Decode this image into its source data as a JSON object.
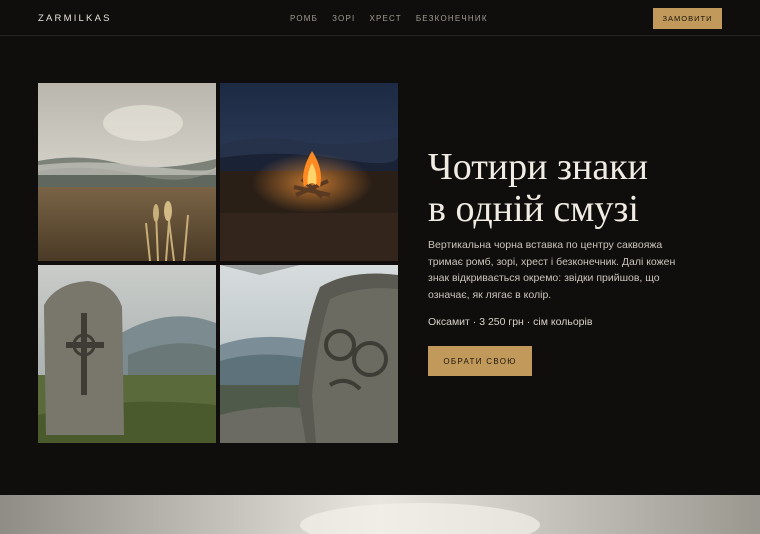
{
  "header": {
    "logo": "ZARMILKAS",
    "nav": [
      "РОМБ",
      "ЗОРІ",
      "ХРЕСТ",
      "БЕЗКОНЕЧНИК"
    ],
    "order_label": "ЗАМОВИТИ"
  },
  "hero": {
    "title_line1": "Чотири знаки",
    "title_line2": "в одній смузі",
    "description": "Вертикальна чорна вставка по центру саквояжа тримає ромб, зорі, хрест і безконечник. Далі кожен знак відкривається окремо: звідки прийшов, що означає, як лягає в колір.",
    "meta": "Оксамит · 3 250 грн · сім кольорів",
    "cta_label": "ОБРАТИ СВОЮ"
  },
  "colors": {
    "accent": "#c19a5b",
    "background": "#0f0e0d"
  }
}
